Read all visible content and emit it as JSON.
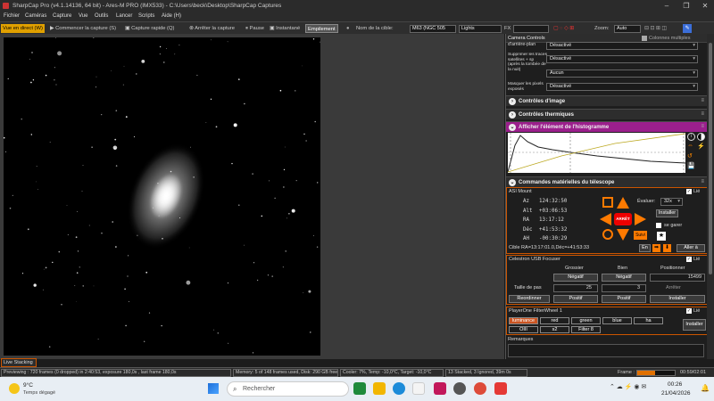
{
  "window": {
    "title": "SharpCap Pro (v4.1.14136, 64 bit) - Ares-M PRO (IMX533) - C:\\Users\\beck\\Desktop\\SharpCap Captures"
  },
  "menu": [
    "Fichier",
    "Caméras",
    "Capture",
    "Vue",
    "Outils",
    "Lancer",
    "Scripts",
    "Aide (H)"
  ],
  "toolbar": {
    "live": "Vue en direct (W)",
    "start": "Commencer la capture (S)",
    "quick": "Capture rapide (Q)",
    "stop": "Arrêter la capture",
    "pause": "Pause",
    "snapshot": "Instantané",
    "stack": "Empilement",
    "target_label": "Nom de la cible:",
    "target": "M63 (NGC 505",
    "frame_type": "Lights",
    "fx": "FX",
    "zoom_label": "Zoom:",
    "zoom": "Auto"
  },
  "panel": {
    "camera_controls": "Camera Controls",
    "multi_cols": "Colonnes multiples",
    "arriere_plan": "d'arrière-plan",
    "arriere_val": "Désactivé",
    "satellite_label": "Supprimer les traces satellites + sp (après la tombée de la nuit)",
    "satellite_val": "Désactivé",
    "timing_val": "Aucun",
    "masquer_label": "Masquer les pixels exposés",
    "masquer_val": "Désactivé",
    "image_controls": "Contrôles d'image",
    "thermal": "Contrôles thermiques",
    "histogram": "Afficher l'élément de l'histogramme",
    "telescope": "Commandes matérielles du télescope",
    "mount": "ASI Mount",
    "lie": "Lié",
    "az": "Az",
    "az_val": "124:32:50",
    "alt": "Alt",
    "alt_val": "+03:06:53",
    "ra": "RA",
    "ra_val": "13:17:12",
    "dec": "Déc",
    "dec_val": "+41:53:32",
    "ah": "AH",
    "ah_val": "-00:30:29",
    "stop": "ARRÊT",
    "suivi": "Suivi",
    "evaluer": "Évaluer:",
    "rate": "32x",
    "installer": "Installer",
    "se_garer": "se garer",
    "cible": "Cible   RA=13:17:01.0,Déc=+41:53:33",
    "en": "En",
    "aller": "Aller à",
    "focuser": "Celestron USB Focuser",
    "grossier": "Grossier",
    "bien": "Bien",
    "positionner": "Positionner",
    "negatif": "Négatif",
    "position": "15499",
    "taille": "Taille de pas",
    "coarse_step": "25",
    "fine_step": "3",
    "arreter": "Arrêter",
    "reordonner": "Reordinner",
    "positif": "Positif",
    "filterwheel": "PlayerOne FilterWheel 1",
    "filters": [
      "luminance",
      "red",
      "green",
      "blue",
      "ha",
      "OIII",
      "s2",
      "Filter 8"
    ],
    "remarques": "Remarques"
  },
  "status": {
    "live_stacking": "Live Stacking",
    "previewing": "Previewing : 720 frames (0 dropped) in 2:40:53, exposure 180,0s , last frame 180,0s",
    "memory": "Memory: 5 of 148 frames used, Disk: 290 GB free",
    "cooler": "Cooler: 7%, Temp: -10,0°C, Target: -10,0°C",
    "stacked": "13 Stacked, 3 Ignored, 39m 0s",
    "frame": "Frame :",
    "time": "00:59/02:01"
  },
  "taskbar": {
    "temp": "9°C",
    "weather": "Temps dégagé",
    "search": "Rechercher",
    "clock": "00:26",
    "date": "21/04/2026"
  },
  "colors": {
    "accent": "#e0a000",
    "histogram": "#9b1f8c",
    "orange": "#ff7a00"
  }
}
